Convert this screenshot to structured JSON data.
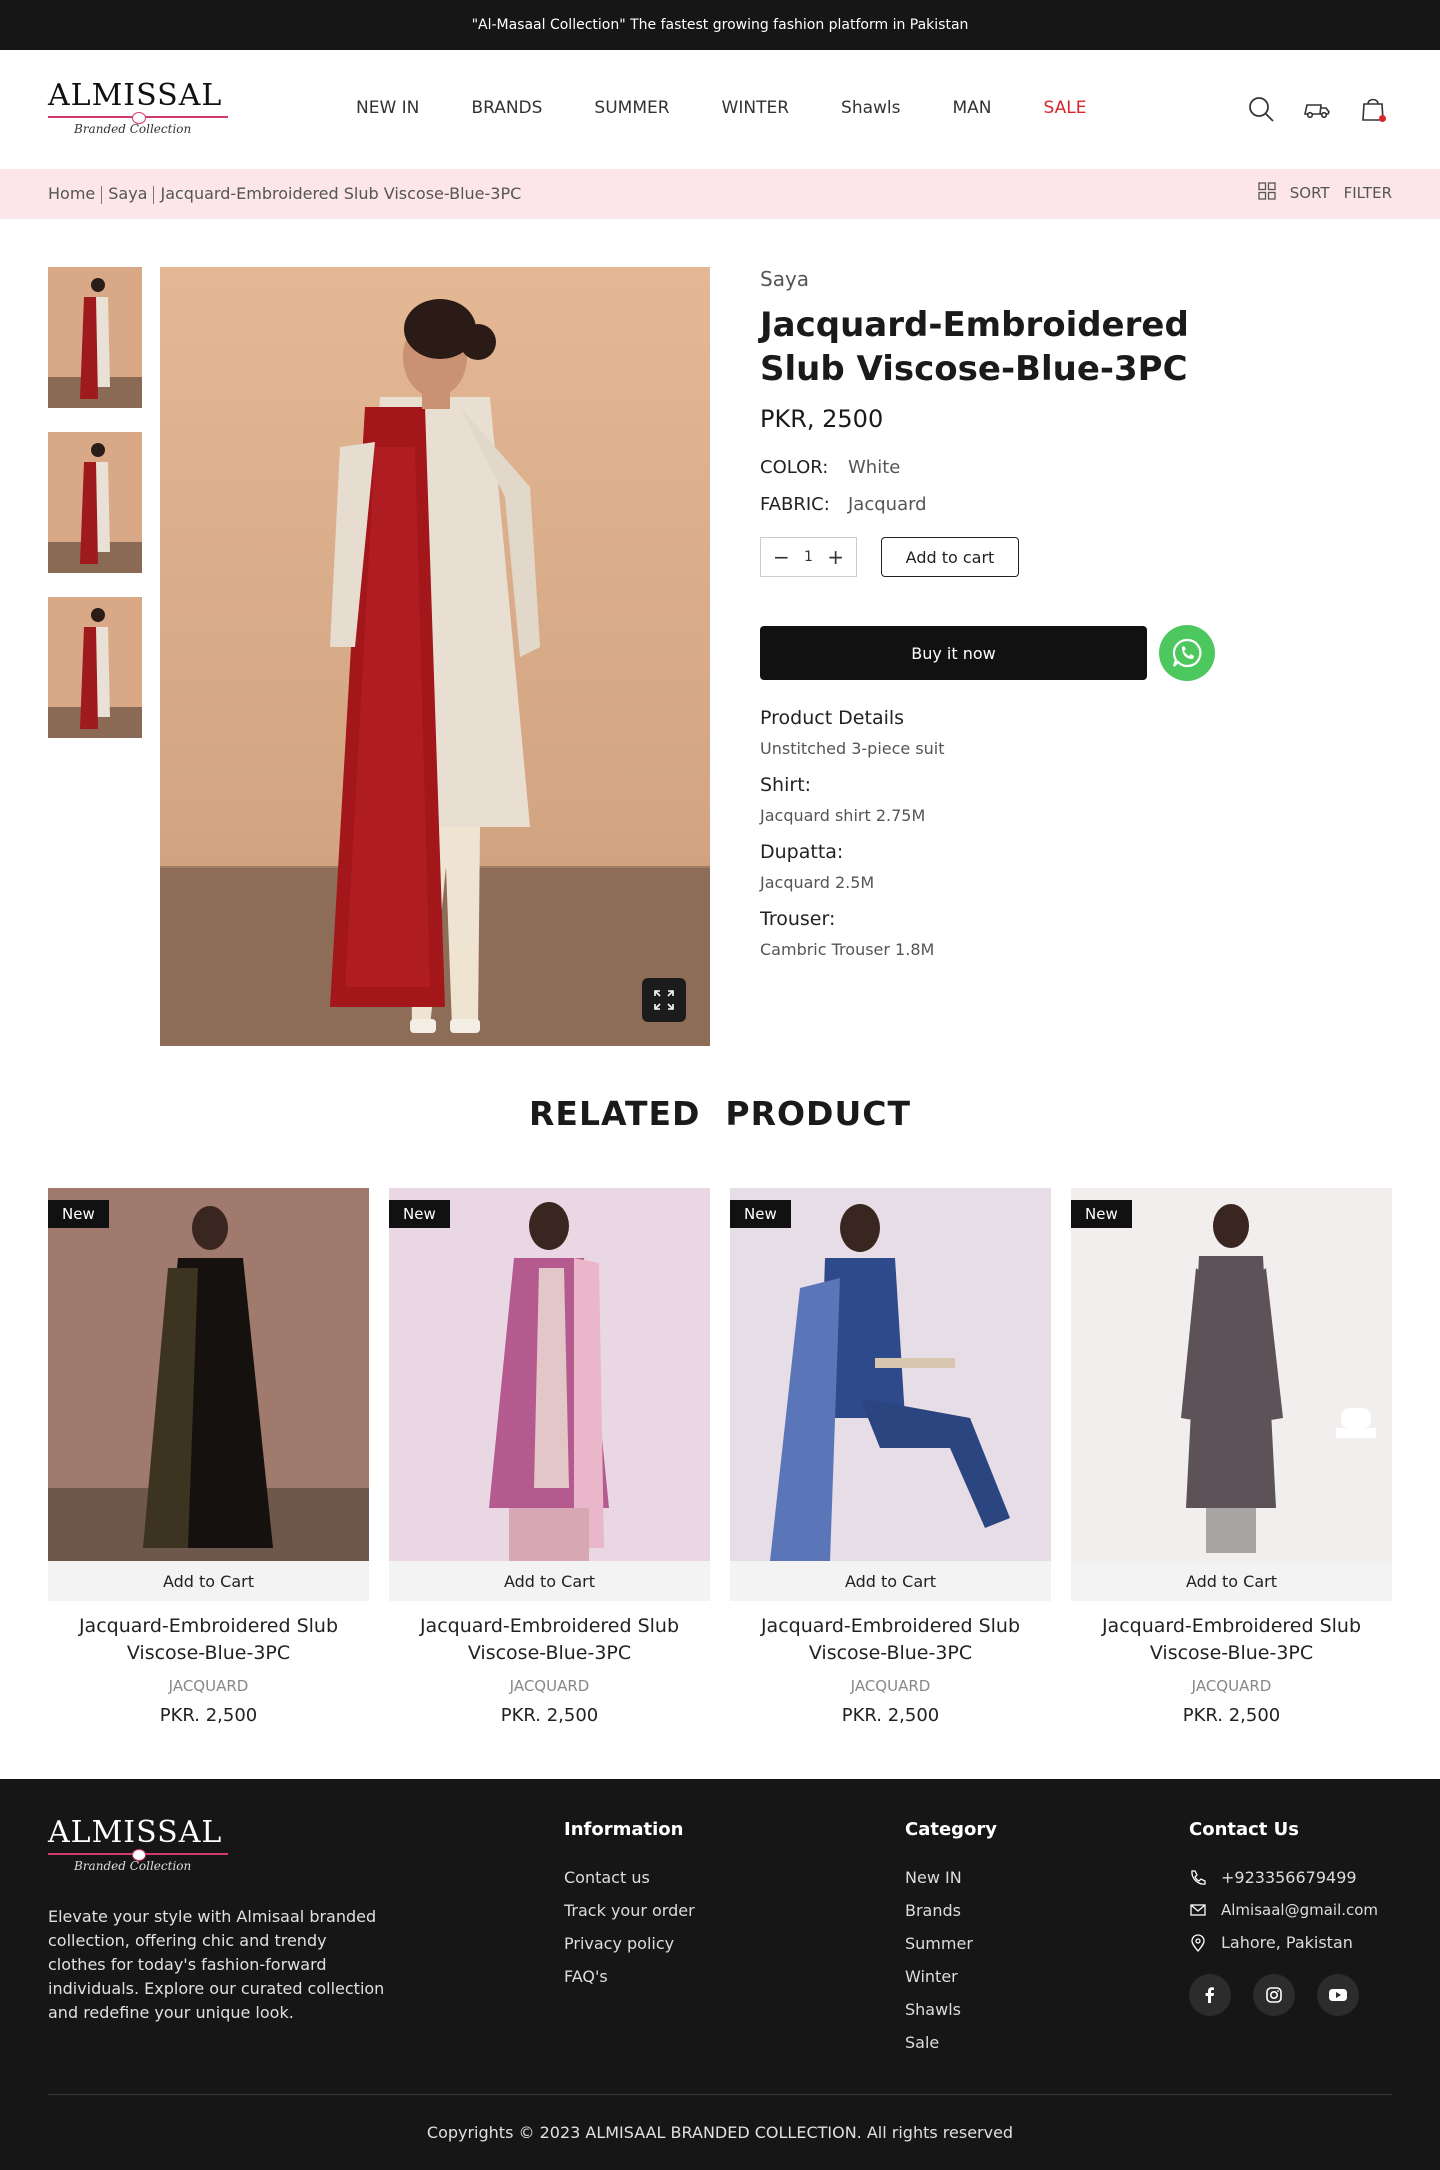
{
  "announcement": "\"Al-Masaal Collection\" The fastest growing fashion platform in Pakistan",
  "logo": {
    "word": "ALMISSAL",
    "sub": "Branded Collection"
  },
  "nav": {
    "items": [
      "NEW IN",
      "BRANDS",
      "SUMMER",
      "WINTER",
      "Shawls",
      "MAN",
      "SALE"
    ]
  },
  "header_icons": [
    "search-icon",
    "delivery-truck-icon",
    "shopping-bag-icon"
  ],
  "breadcrumb": {
    "items": [
      "Home",
      "Saya",
      "Jacquard-Embroidered Slub Viscose-Blue-3PC"
    ],
    "sort": "SORT",
    "filter": "FILTER"
  },
  "product": {
    "brand": "Saya",
    "title": "Jacquard-Embroidered Slub Viscose-Blue-3PC",
    "price": "PKR, 2500",
    "color_label": "COLOR:",
    "color_value": "White",
    "fabric_label": "FABRIC:",
    "fabric_value": "Jacquard",
    "quantity": "1",
    "add_to_cart": "Add to cart",
    "buy_now": "Buy it now",
    "details_heading": "Product Details",
    "details_value": "Unstitched 3-piece suit",
    "shirt_heading": "Shirt:",
    "shirt_value": "Jacquard shirt 2.75M",
    "dupatta_heading": "Dupatta:",
    "dupatta_value": "Jacquard 2.5M",
    "trouser_heading": "Trouser:",
    "trouser_value": "Cambric Trouser 1.8M"
  },
  "related": {
    "heading": "RELATED  PRODUCT",
    "cards": [
      {
        "badge": "New",
        "add": "Add to Cart",
        "name": "Jacquard-Embroidered Slub Viscose-Blue-3PC",
        "category": "JACQUARD",
        "price": "PKR. 2,500"
      },
      {
        "badge": "New",
        "add": "Add to Cart",
        "name": "Jacquard-Embroidered Slub Viscose-Blue-3PC",
        "category": "JACQUARD",
        "price": "PKR. 2,500"
      },
      {
        "badge": "New",
        "add": "Add to Cart",
        "name": "Jacquard-Embroidered Slub Viscose-Blue-3PC",
        "category": "JACQUARD",
        "price": "PKR. 2,500"
      },
      {
        "badge": "New",
        "add": "Add to Cart",
        "name": "Jacquard-Embroidered Slub Viscose-Blue-3PC",
        "category": "JACQUARD",
        "price": "PKR. 2,500"
      }
    ]
  },
  "footer": {
    "about": "Elevate your style with Almisaal branded collection, offering chic and trendy clothes for today's fashion-forward individuals. Explore our curated collection and redefine your unique look.",
    "information": {
      "heading": "Information",
      "links": [
        "Contact us",
        "Track your order",
        "Privacy policy",
        "FAQ's"
      ]
    },
    "category": {
      "heading": "Category",
      "links": [
        "New IN",
        "Brands",
        "Summer",
        "Winter",
        "Shawls",
        "Sale"
      ]
    },
    "contact": {
      "heading": "Contact Us",
      "phone": "+923356679499",
      "email": "Almisaal@gmail.com",
      "location": "Lahore, Pakistan"
    },
    "social": [
      "facebook-icon",
      "instagram-icon",
      "youtube-icon"
    ],
    "copyright": "Copyrights © 2023 ALMISAAL BRANDED COLLECTION. All rights reserved"
  },
  "colors": {
    "topbar": "#161616",
    "breadcrumb_bg": "#fce6ea",
    "sale": "#d9252b",
    "whatsapp": "#4cc85f",
    "accent": "#d23a6a"
  }
}
